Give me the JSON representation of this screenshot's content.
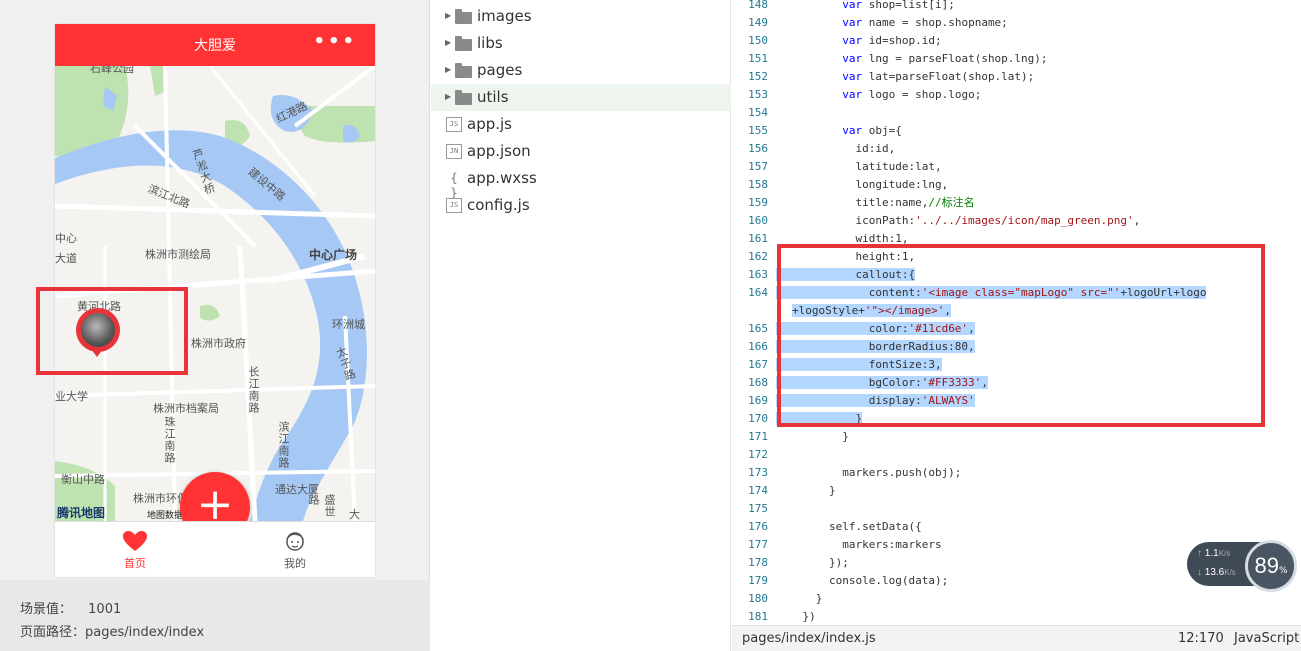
{
  "simulator": {
    "nav_title": "大胆爱",
    "nav_more": "•••",
    "map": {
      "labels": {
        "top_partial": "石峰公园",
        "north_road": "红港路",
        "bridge": "芦淞大桥",
        "jiangbin_north": "滨江北路",
        "jianshe_middle": "建设中路",
        "center_partial": "中心",
        "dadao_partial": "大道",
        "survey_institute": "株洲市测绘局",
        "central_plaza": "中心广场",
        "huanghe_north": "黄河北路",
        "huanjiang_city": "环洲城",
        "city_government": "株洲市政府",
        "changjiang_south": "长江南路",
        "taizi_road": "太子路",
        "university_partial": "业大学",
        "archives": "株洲市档案局",
        "zhujiang_south": "珠江南路",
        "binjiang_south": "滨江南路",
        "hengshan_middle": "衡山中路",
        "env_bureau": "株洲市环保局",
        "tongda_building": "通达大厦",
        "shengshi_road": "盛世路",
        "da_partial": "大"
      },
      "logo": "腾讯地图",
      "copyright": "地图数据"
    },
    "fab_label": "+",
    "tabs": [
      {
        "label": "首页",
        "icon": "heart-icon",
        "active": true
      },
      {
        "label": "我的",
        "icon": "user-face-icon",
        "active": false
      }
    ],
    "scene_label": "场景值：",
    "scene_value": "1001",
    "page_path_label": "页面路径：",
    "page_path": "pages/index/index",
    "colors": {
      "brand": "#ff3333",
      "highlight_box": "#e8333a"
    }
  },
  "file_tree": [
    {
      "name": "images",
      "type": "folder",
      "selected": false
    },
    {
      "name": "libs",
      "type": "folder",
      "selected": false
    },
    {
      "name": "pages",
      "type": "folder",
      "selected": false
    },
    {
      "name": "utils",
      "type": "folder",
      "selected": true
    },
    {
      "name": "app.js",
      "type": "file",
      "badge": "JS"
    },
    {
      "name": "app.json",
      "type": "file",
      "badge": "JN"
    },
    {
      "name": "app.wxss",
      "type": "file",
      "badge": "{ }"
    },
    {
      "name": "config.js",
      "type": "file",
      "badge": "JS"
    }
  ],
  "editor": {
    "lines": [
      {
        "n": "148",
        "text": "          var shop=list[i];"
      },
      {
        "n": "149",
        "text": "          var name = shop.shopname;"
      },
      {
        "n": "150",
        "text": "          var id=shop.id;"
      },
      {
        "n": "151",
        "text": "          var lng = parseFloat(shop.lng);"
      },
      {
        "n": "152",
        "text": "          var lat=parseFloat(shop.lat);"
      },
      {
        "n": "153",
        "text": "          var logo = shop.logo;"
      },
      {
        "n": "154",
        "text": ""
      },
      {
        "n": "155",
        "text": "          var obj={"
      },
      {
        "n": "156",
        "text": "            id:id,"
      },
      {
        "n": "157",
        "text": "            latitude:lat,"
      },
      {
        "n": "158",
        "text": "            longitude:lng,"
      },
      {
        "n": "159",
        "text": "            title:name,//标注名"
      },
      {
        "n": "160",
        "text": "            iconPath:'../../images/icon/map_green.png',"
      },
      {
        "n": "161",
        "text": "            width:1,"
      },
      {
        "n": "162",
        "text": "            height:1,"
      },
      {
        "n": "163",
        "text": "            callout:{",
        "hl": true
      },
      {
        "n": "164",
        "text": "              content:'<image class=\"mapLogo\" src=\"'+logoUrl+logo",
        "hl": true
      },
      {
        "n": "",
        "text": "+logoStyle+'\"></image>',",
        "hl": true,
        "wrap": true
      },
      {
        "n": "165",
        "text": "              color:'#11cd6e',",
        "hl": true
      },
      {
        "n": "166",
        "text": "              borderRadius:80,",
        "hl": true
      },
      {
        "n": "167",
        "text": "              fontSize:3,",
        "hl": true
      },
      {
        "n": "168",
        "text": "              bgColor:'#FF3333',",
        "hl": true
      },
      {
        "n": "169",
        "text": "              display:'ALWAYS'",
        "hl": true
      },
      {
        "n": "170",
        "text": "            }",
        "hl": true
      },
      {
        "n": "171",
        "text": "          }"
      },
      {
        "n": "172",
        "text": ""
      },
      {
        "n": "173",
        "text": "          markers.push(obj);"
      },
      {
        "n": "174",
        "text": "        }"
      },
      {
        "n": "175",
        "text": ""
      },
      {
        "n": "176",
        "text": "        self.setData({"
      },
      {
        "n": "177",
        "text": "          markers:markers"
      },
      {
        "n": "178",
        "text": "        });"
      },
      {
        "n": "179",
        "text": "        console.log(data);"
      },
      {
        "n": "180",
        "text": "      }"
      },
      {
        "n": "181",
        "text": "    })"
      }
    ],
    "status": {
      "path": "pages/index/index.js",
      "position": "12:170",
      "language": "JavaScript"
    }
  },
  "net_widget": {
    "upload": "1.1",
    "upload_unit": "K/s",
    "download": "13.6",
    "download_unit": "K/s",
    "percent": "89",
    "percent_sign": "%"
  }
}
